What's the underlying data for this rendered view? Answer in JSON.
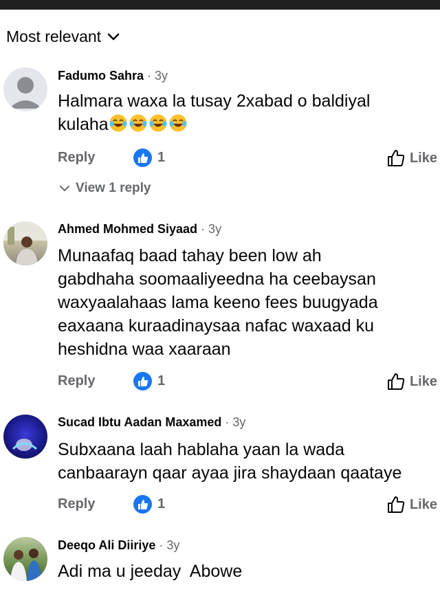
{
  "sort": {
    "label": "Most relevant"
  },
  "comments": [
    {
      "author": "Fadumo Sahra",
      "age": "· 3y",
      "text_lines": [
        "Halmara waxa la tusay 2xabad o baldiyal",
        "kulaha"
      ],
      "emojis": [
        "laughing-tears-emoji",
        "laughing-tears-emoji",
        "laughing-tears-emoji",
        "laughing-tears-emoji"
      ],
      "reply_label": "Reply",
      "reaction_count": "1",
      "like_label": "Like",
      "view_replies": "View 1 reply",
      "avatar": "default-avatar"
    },
    {
      "author": "Ahmed Mohmed Siyaad",
      "age": "· 3y",
      "text_lines": [
        "Munaafaq baad tahay been low ah",
        "gabdhaha soomaaliyeedna ha ceebaysan",
        "waxyaalahaas lama keeno fees buugyada",
        "eaxaana kuraadinaysaa nafac waxaad ku",
        "heshidna waa xaaraan"
      ],
      "reply_label": "Reply",
      "reaction_count": "1",
      "like_label": "Like",
      "avatar": "photo-avatar"
    },
    {
      "author": "Sucad Ibtu Aadan Maxamed",
      "age": "· 3y",
      "text_lines": [
        "Subxaana laah hablaha yaan la wada",
        "canbaarayn qaar ayaa jira shaydaan qaataye"
      ],
      "reply_label": "Reply",
      "reaction_count": "1",
      "like_label": "Like",
      "avatar": "photo-avatar"
    },
    {
      "author": "Deeqo Ali Diiriye",
      "age": "· 3y",
      "text_lines": [
        "Adi ma u jeeday  Abowe"
      ],
      "avatar": "photo-avatar"
    }
  ],
  "colors": {
    "accent": "#1877f2",
    "secondary_text": "#65676b"
  }
}
